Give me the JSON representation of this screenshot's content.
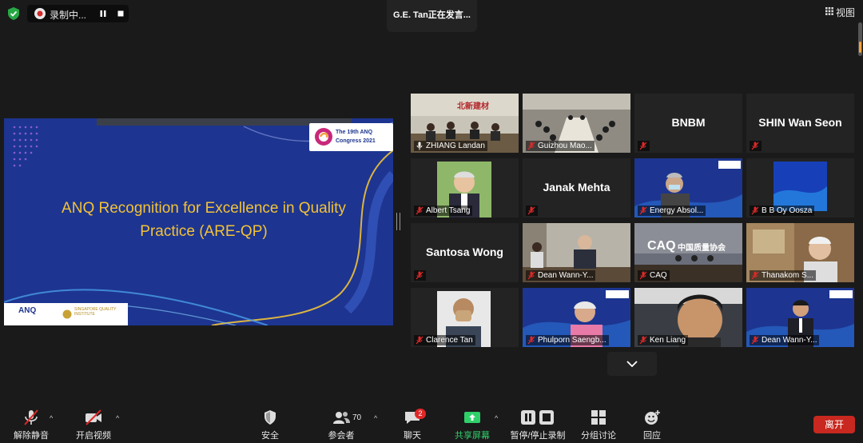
{
  "top_bar": {
    "recording_label": "录制中...",
    "speaking_label": "G.E. Tan正在发言...",
    "view_label": "视图"
  },
  "shared_slide": {
    "congress_line1": "The 19th ANQ",
    "congress_line2": "Congress 2021",
    "title_line1": "ANQ Recognition for Excellence in Quality",
    "title_line2": "Practice (ARE-QP)",
    "footer_left": "ANQ",
    "footer_right": "SINGAPORE QUALITY INSTITUTE"
  },
  "participants": [
    {
      "name": "ZHIANG Landan",
      "big_name": "",
      "muted": false
    },
    {
      "name": "Guizhou Mao...",
      "big_name": "",
      "muted": true
    },
    {
      "name": "",
      "big_name": "BNBM",
      "muted": true
    },
    {
      "name": "",
      "big_name": "SHIN Wan Seon",
      "muted": true
    },
    {
      "name": "Albert Tsang",
      "big_name": "",
      "muted": true
    },
    {
      "name": "",
      "big_name": "Janak Mehta",
      "muted": true
    },
    {
      "name": "Energy Absol...",
      "big_name": "",
      "muted": true
    },
    {
      "name": "B B Oy Oosza",
      "big_name": "",
      "muted": true
    },
    {
      "name": "",
      "big_name": "Santosa Wong",
      "muted": true
    },
    {
      "name": "Dean Wann-Y...",
      "big_name": "",
      "muted": true
    },
    {
      "name": "CAQ",
      "big_name": "",
      "muted": true
    },
    {
      "name": "Thanakom S...",
      "big_name": "",
      "muted": true
    },
    {
      "name": "Clarence Tan",
      "big_name": "",
      "muted": true
    },
    {
      "name": "Phulporn Saengb...",
      "big_name": "",
      "muted": true
    },
    {
      "name": "Ken Liang",
      "big_name": "",
      "muted": true
    },
    {
      "name": "Dean Wann-Y...",
      "big_name": "",
      "muted": true
    }
  ],
  "tile_text": {
    "caq_logo": "CAQ",
    "caq_cn": "中国质量协会",
    "zhiang_sign": "北新建材"
  },
  "toolbar": {
    "unmute": "解除静音",
    "start_video": "开启视频",
    "security": "安全",
    "participants": "参会者",
    "participants_count": "70",
    "chat": "聊天",
    "chat_badge": "2",
    "share": "共享屏幕",
    "record": "暂停/停止录制",
    "breakout": "分组讨论",
    "reactions": "回应",
    "leave": "离开"
  },
  "colors": {
    "share_green": "#2fd06a",
    "leave_red": "#c8281f",
    "muted_red": "#e02828",
    "slide_blue": "#1d3590",
    "slide_gold": "#f3c237"
  }
}
